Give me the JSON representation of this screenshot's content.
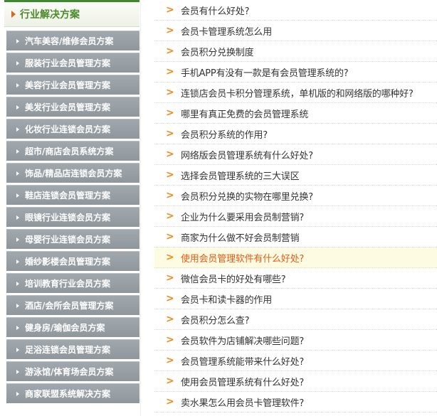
{
  "sidebar": {
    "header": "行业解决方案",
    "items": [
      {
        "label": "汽车美容/维修会员方案"
      },
      {
        "label": "服装行业会员管理方案"
      },
      {
        "label": "美容行业会员管理方案"
      },
      {
        "label": "美发行业会员管理方案"
      },
      {
        "label": "化妆行业连锁会员方案"
      },
      {
        "label": "超市/商店会员系统方案"
      },
      {
        "label": "饰品/精品店连锁会员方案"
      },
      {
        "label": "鞋店连锁会员管理方案"
      },
      {
        "label": "眼镜行业连锁会员方案"
      },
      {
        "label": "母婴行业连锁会员方案"
      },
      {
        "label": "婚纱影楼会员管理方案"
      },
      {
        "label": "培训教育行业会员方案"
      },
      {
        "label": "酒店/会所会员管理方案"
      },
      {
        "label": "健身房/瑜伽会员方案"
      },
      {
        "label": "足浴连锁会员管理方案"
      },
      {
        "label": "游泳馆/体育场会员方案"
      },
      {
        "label": "商家联盟系统解决方案"
      }
    ]
  },
  "articles": [
    {
      "title": "会员有什么好处?"
    },
    {
      "title": "会员卡管理系统怎么用"
    },
    {
      "title": "会员积分兑换制度"
    },
    {
      "title": "手机APP有没有一款是有会员管理系统的?"
    },
    {
      "title": "连锁店会员卡积分管理系统，单机版的和网络版的哪种好?"
    },
    {
      "title": "哪里有真正免费的会员管理系统"
    },
    {
      "title": "会员积分系统的作用?"
    },
    {
      "title": "网络版会员管理系统有什么好处?"
    },
    {
      "title": "选择会员管理系统的三大误区"
    },
    {
      "title": "会员积分兑换的实物在哪里兑换?"
    },
    {
      "title": "企业为什么要采用会员制营销?"
    },
    {
      "title": "商家为什么做不好会员制营销"
    },
    {
      "title": "使用会员管理软件有什么好处?",
      "highlighted": true
    },
    {
      "title": "微信会员卡的好处有哪些?"
    },
    {
      "title": "会员卡和读卡器的作用"
    },
    {
      "title": "会员积分怎么查?"
    },
    {
      "title": "会员软件为店铺解决哪些问题?"
    },
    {
      "title": "会员管理系统能带来什么好处?"
    },
    {
      "title": "使用会员管理系统有什么好处?"
    },
    {
      "title": "卖水果怎么用会员卡管理软件?"
    }
  ],
  "icons": {
    "article_bullet": ">"
  },
  "colors": {
    "header_text": "#4a8b2a",
    "sidebar_item_bg": "#969ea4",
    "bullet_orange": "#f08a1c",
    "highlight_bg": "#fdfbe1",
    "highlight_text": "#e85a12"
  }
}
